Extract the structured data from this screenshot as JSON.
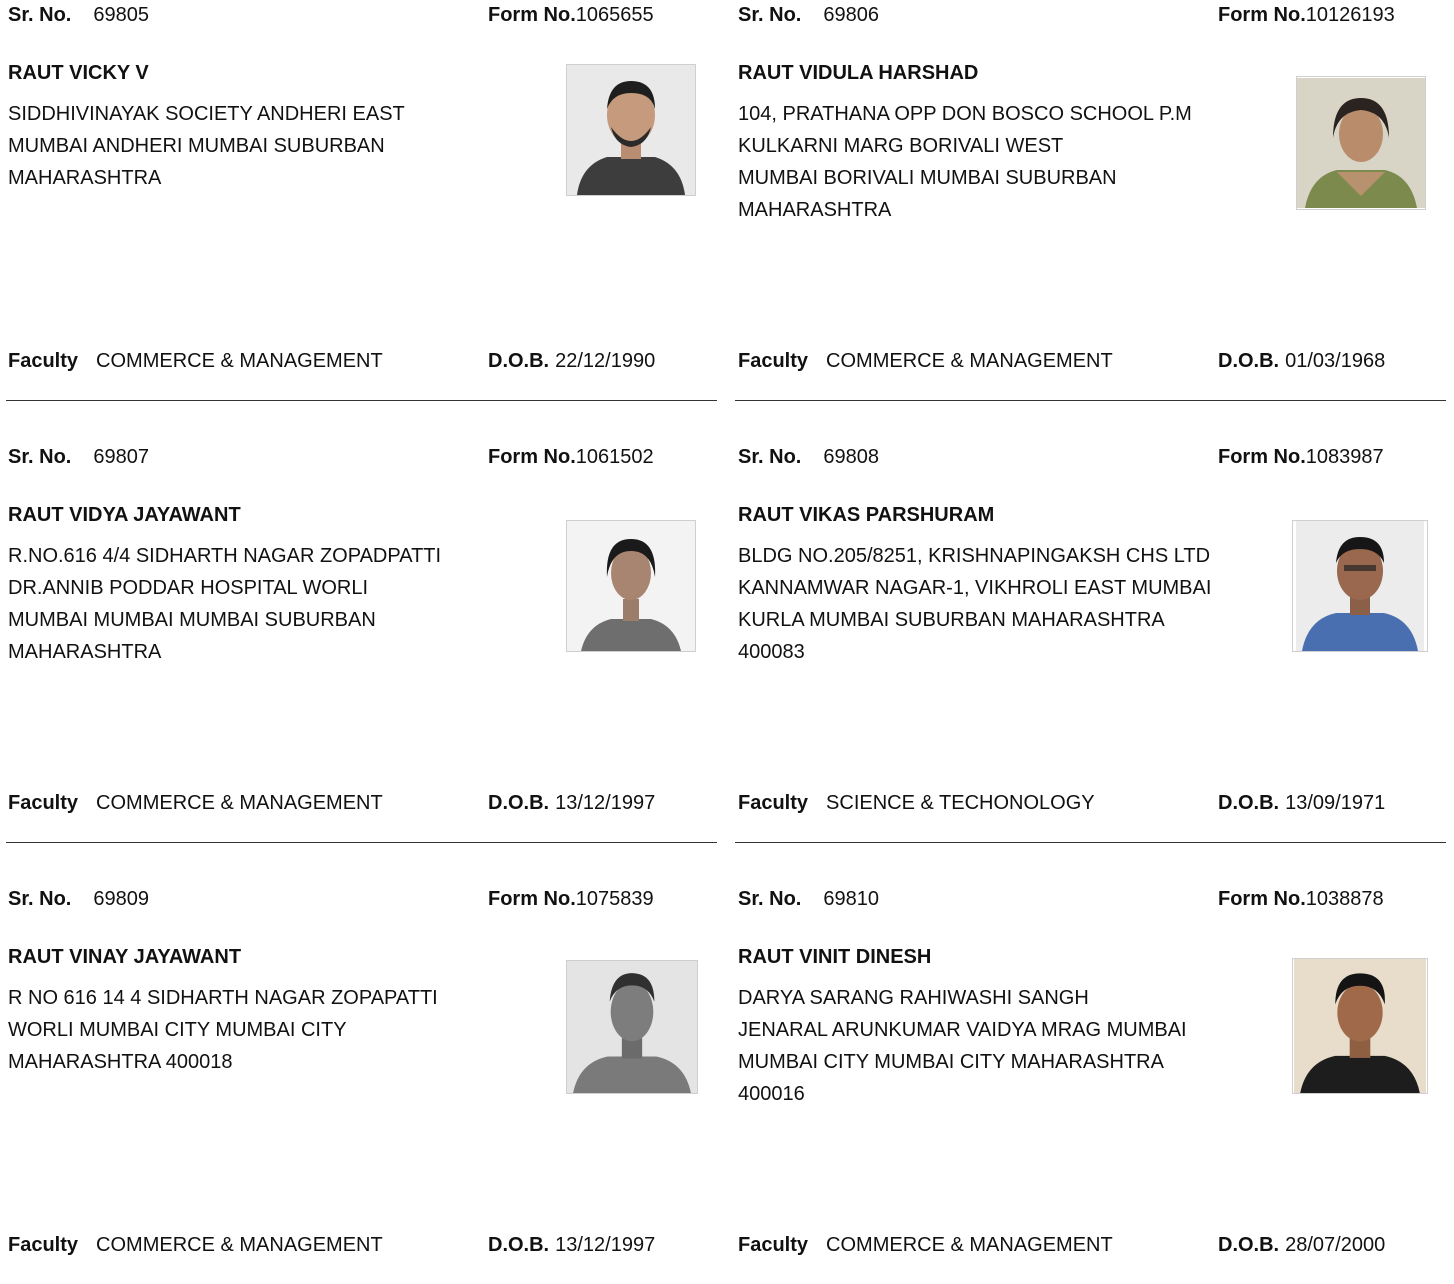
{
  "labels": {
    "sr_no": "Sr. No.",
    "form_no": "Form No.",
    "faculty": "Faculty",
    "dob": "D.O.B."
  },
  "records": [
    {
      "sr_no": "69805",
      "form_no": "1065655",
      "name": "RAUT VICKY V",
      "address": "SIDDHIVINAYAK SOCIETY ANDHERI EAST\n MUMBAI ANDHERI MUMBAI SUBURBAN\nMAHARASHTRA",
      "faculty": "COMMERCE & MANAGEMENT",
      "dob": "22/12/1990"
    },
    {
      "sr_no": "69806",
      "form_no": "10126193",
      "name": "RAUT VIDULA HARSHAD",
      "address": "104, PRATHANA OPP DON BOSCO SCHOOL P.M\nKULKARNI MARG BORIVALI WEST\n MUMBAI BORIVALI MUMBAI SUBURBAN\nMAHARASHTRA",
      "faculty": "COMMERCE & MANAGEMENT",
      "dob": "01/03/1968"
    },
    {
      "sr_no": "69807",
      "form_no": "1061502",
      "name": "RAUT VIDYA JAYAWANT",
      "address": "R.NO.616 4/4 SIDHARTH NAGAR ZOPADPATTI\nDR.ANNIB PODDAR HOSPITAL WORLI\n MUMBAI MUMBAI MUMBAI SUBURBAN\nMAHARASHTRA",
      "faculty": "COMMERCE & MANAGEMENT",
      "dob": "13/12/1997"
    },
    {
      "sr_no": "69808",
      "form_no": "1083987",
      "name": "RAUT VIKAS PARSHURAM",
      "address": "BLDG NO.205/8251, KRISHNAPINGAKSH  CHS LTD\nKANNAMWAR NAGAR-1, VIKHROLI EAST MUMBAI\nKURLA MUMBAI SUBURBAN MAHARASHTRA\n400083",
      "faculty": "SCIENCE & TECHONOLOGY",
      "dob": "13/09/1971"
    },
    {
      "sr_no": "69809",
      "form_no": "1075839",
      "name": "RAUT VINAY JAYAWANT",
      "address": "R NO 616 14 4 SIDHARTH NAGAR ZOPAPATTI\n WORLI MUMBAI CITY MUMBAI CITY\nMAHARASHTRA 400018",
      "faculty": "COMMERCE & MANAGEMENT",
      "dob": "13/12/1997"
    },
    {
      "sr_no": "69810",
      "form_no": "1038878",
      "name": "RAUT VINIT DINESH",
      "address": "DARYA SARANG RAHIWASHI SANGH\nJENARAL ARUNKUMAR VAIDYA MRAG MUMBAI\nMUMBAI CITY MUMBAI CITY MAHARASHTRA\n400016",
      "faculty": "COMMERCE & MANAGEMENT",
      "dob": "28/07/2000"
    }
  ]
}
